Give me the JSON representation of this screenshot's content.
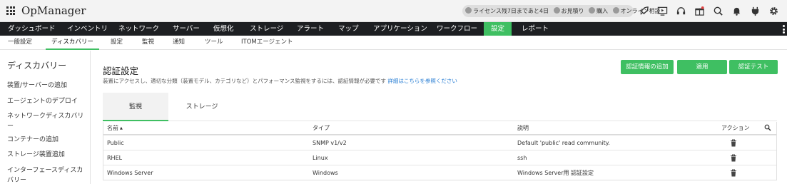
{
  "app": {
    "title": "OpManager"
  },
  "promo": {
    "license": "ライセンス残7日まであと4日",
    "quote": "お見積り",
    "buy": "購入",
    "consult": "オンライン相談"
  },
  "top_icons": [
    "rocket-icon",
    "monitor-play-icon",
    "headset-icon",
    "gift-icon",
    "search-icon",
    "bell-icon",
    "plug-icon",
    "gear-icon",
    "user-icon"
  ],
  "main_nav": [
    "ダッシュボード",
    "インベントリ",
    "ネットワーク",
    "サーバー",
    "仮想化",
    "ストレージ",
    "アラート",
    "マップ",
    "アプリケーション",
    "ワークフロー",
    "設定",
    "レポート"
  ],
  "main_nav_active": "設定",
  "sub_nav": [
    "一般設定",
    "ディスカバリー",
    "設定",
    "監視",
    "通知",
    "ツール",
    "ITOMエージェント"
  ],
  "sub_nav_active": "ディスカバリー",
  "sidebar": {
    "title": "ディスカバリー",
    "links": [
      "装置/サーバーの追加",
      "エージェントのデプロイ",
      "ネットワークディスカバリー",
      "コンテナーの追加",
      "ストレージ装置追加",
      "インターフェースディスカバリー"
    ]
  },
  "content": {
    "title": "認証設定",
    "description": "装置にアクセスし、適切な分類（装置モデル、カテゴリなど）とパフォーマンス監視をするには、認証情報が必要です",
    "link": "詳細はこちらを参照ください",
    "buttons": {
      "add": "認証情報の追加",
      "apply": "適用",
      "test": "認証テスト"
    },
    "tabs": [
      "監視",
      "ストレージ"
    ],
    "active_tab": "監視"
  },
  "table": {
    "columns": [
      "名前",
      "タイプ",
      "説明",
      "アクション"
    ],
    "sort_indicator": "▲",
    "rows": [
      {
        "name": "Public",
        "type": "SNMP v1/v2",
        "description": "Default 'public' read community."
      },
      {
        "name": "RHEL",
        "type": "Linux",
        "description": "ssh"
      },
      {
        "name": "Windows Server",
        "type": "Windows",
        "description": "Windows Server用 認証設定"
      }
    ]
  },
  "colors": {
    "accent": "#3fbf62",
    "nav_bg": "#1d1f22",
    "link": "#2a7fd4"
  }
}
